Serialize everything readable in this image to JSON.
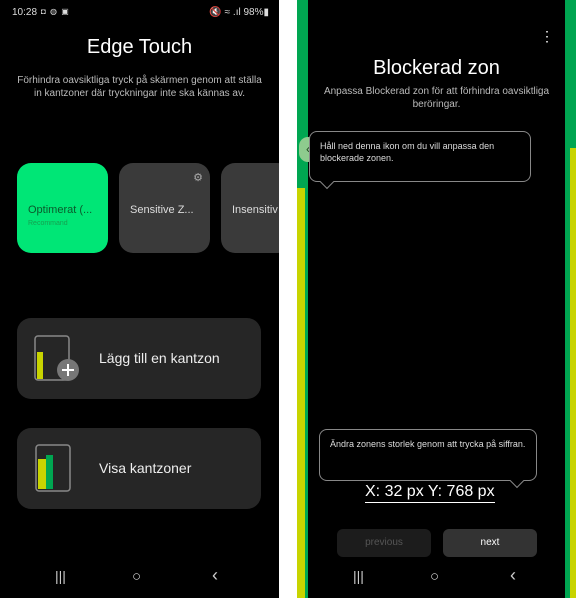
{
  "status_bar": {
    "time": "10:28",
    "left_icons": "◘ ◍ ▣",
    "right_icons": "🔇 ≈ .ıl 98%▮"
  },
  "edge_touch": {
    "title": "Edge Touch",
    "description": "Förhindra oavsiktliga tryck på skärmen genom att ställa in kantzoner där tryckningar inte ska kännas av.",
    "modes": [
      {
        "label": "Optimerat (...",
        "sublabel": "Recommand",
        "active": true
      },
      {
        "label": "Sensitive Z...",
        "has_settings": true
      },
      {
        "label": "Insensitiv"
      }
    ],
    "add_zone_label": "Lägg till en kantzon",
    "show_zones_label": "Visa kantzoner"
  },
  "blocked_zone": {
    "title": "Blockerad zon",
    "description": "Anpassa Blockerad zon för att förhindra oavsiktliga beröringar.",
    "tip_handle": "Håll ned denna ikon om du vill anpassa den blockerade zonen.",
    "tip_resize": "Ändra zonens storlek genom att trycka på siffran.",
    "coords": "X: 32 px Y: 768 px",
    "previous_label": "previous",
    "next_label": "next"
  },
  "nav": {
    "recents": "|||",
    "home": "○",
    "back": "‹"
  },
  "colors": {
    "accent_green": "#00e676",
    "zone_green": "#00a651",
    "zone_yellow": "#c8d400"
  }
}
